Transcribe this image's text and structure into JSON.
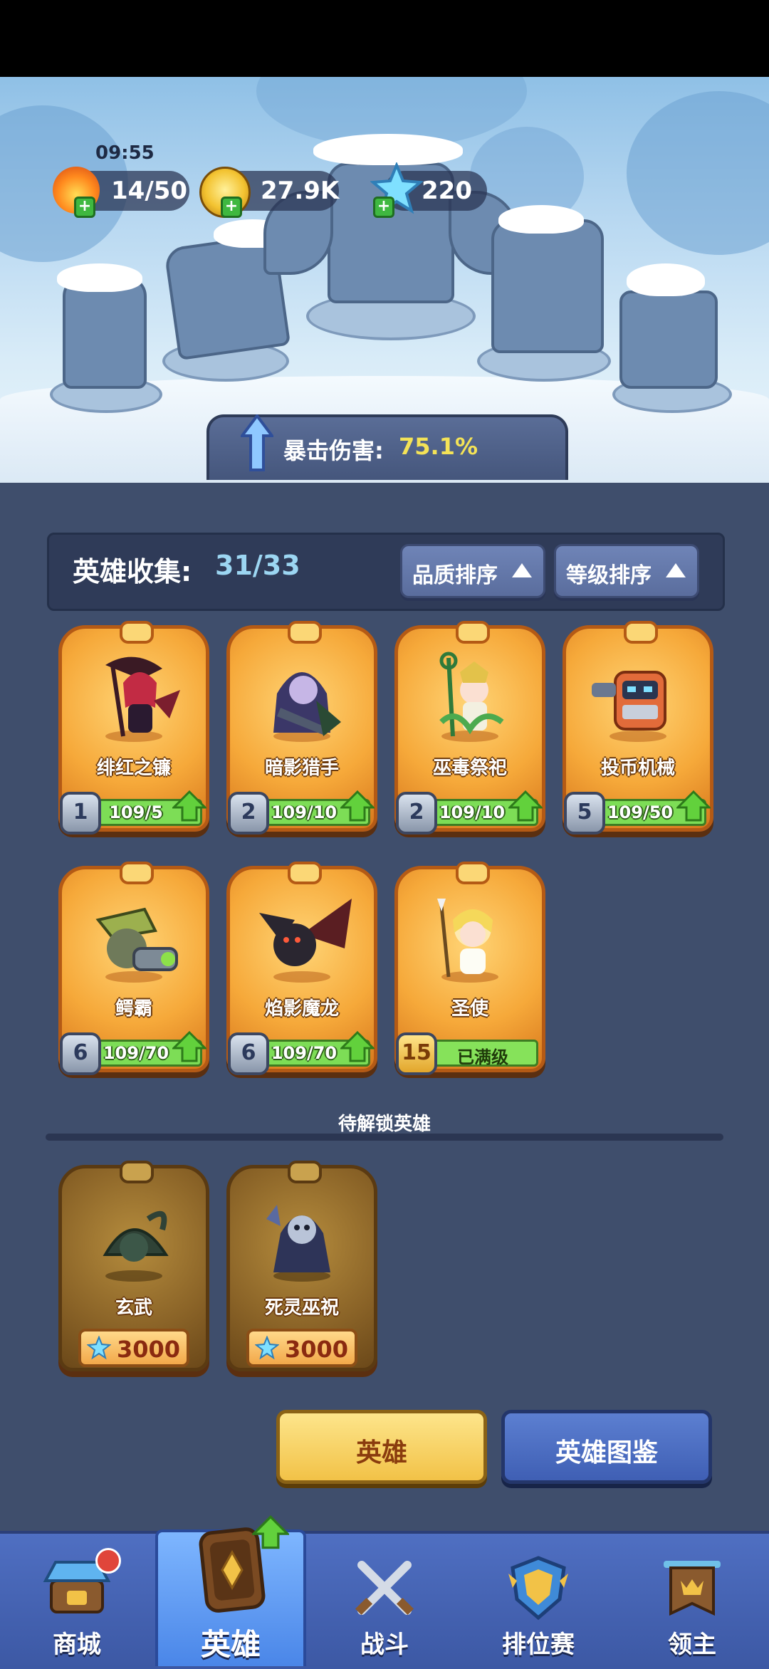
{
  "resources": {
    "stamina_timer": "09:55",
    "stamina": "14/50",
    "gold": "27.9K",
    "gems": "220"
  },
  "banner": {
    "crit_label": "暴击伤害:",
    "crit_value": "75.1%"
  },
  "collection": {
    "label": "英雄收集:",
    "value": "31/33",
    "sort_quality": "品质排序",
    "sort_level": "等级排序"
  },
  "heroes": [
    {
      "name": "绯红之镰",
      "level": "1",
      "progress": "109/5"
    },
    {
      "name": "暗影猎手",
      "level": "2",
      "progress": "109/10"
    },
    {
      "name": "巫毒祭祀",
      "level": "2",
      "progress": "109/10"
    },
    {
      "name": "投币机械",
      "level": "5",
      "progress": "109/50"
    },
    {
      "name": "鳄霸",
      "level": "6",
      "progress": "109/70"
    },
    {
      "name": "焰影魔龙",
      "level": "6",
      "progress": "109/70"
    },
    {
      "name": "圣使",
      "level": "15",
      "progress": "已满级"
    }
  ],
  "pending": {
    "title": "待解锁英雄",
    "heroes": [
      {
        "name": "玄武",
        "price": "3000"
      },
      {
        "name": "死灵巫祝",
        "price": "3000"
      }
    ]
  },
  "buttons": {
    "hero": "英雄",
    "dex": "英雄图鉴"
  },
  "nav": {
    "shop": "商城",
    "hero": "英雄",
    "battle": "战斗",
    "ranked": "排位赛",
    "lord": "领主"
  },
  "colors": {
    "background": "#3f4e6c",
    "card_orange": "#f6a93a",
    "progress_green": "#7ddd56",
    "crit_yellow": "#f4e357",
    "nav_blue": "#4f6fc2"
  }
}
